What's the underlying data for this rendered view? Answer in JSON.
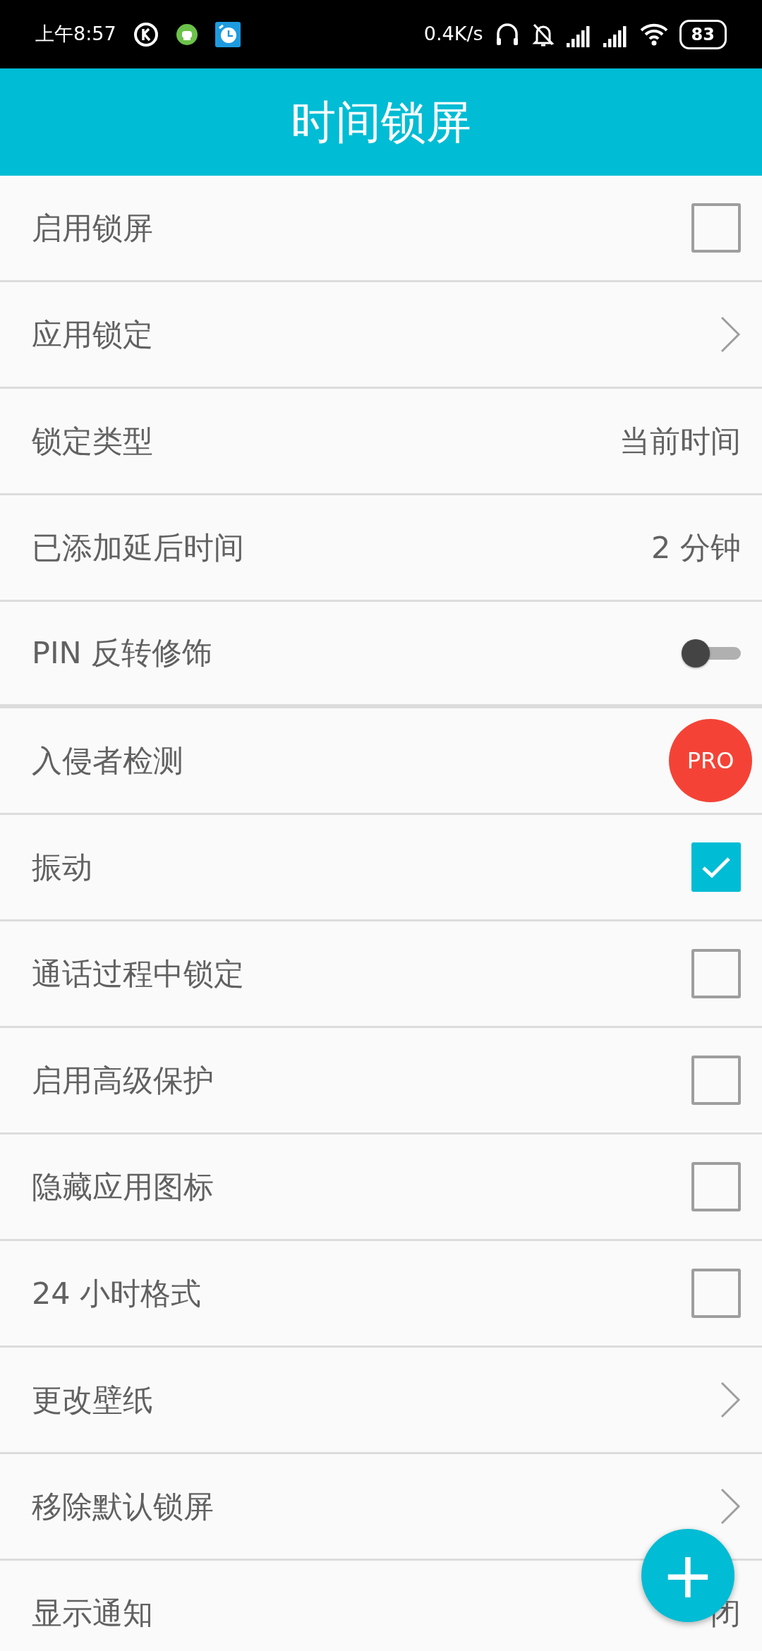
{
  "status_bar": {
    "time": "上午8:57",
    "speed": "0.4K/s",
    "battery": "83"
  },
  "app_bar": {
    "title": "时间锁屏"
  },
  "settings": [
    {
      "kind": "checkbox",
      "label": "启用锁屏",
      "checked": false
    },
    {
      "kind": "link",
      "label": "应用锁定"
    },
    {
      "kind": "value",
      "label": "锁定类型",
      "value": "当前时间"
    },
    {
      "kind": "value",
      "label": "已添加延后时间",
      "value": "2 分钟"
    },
    {
      "kind": "toggle",
      "label": "PIN 反转修饰",
      "on": false
    },
    {
      "kind": "pro",
      "label": "入侵者检测",
      "badge": "PRO"
    },
    {
      "kind": "checkbox",
      "label": "振动",
      "checked": true
    },
    {
      "kind": "checkbox",
      "label": "通话过程中锁定",
      "checked": false
    },
    {
      "kind": "checkbox",
      "label": "启用高级保护",
      "checked": false
    },
    {
      "kind": "checkbox",
      "label": "隐藏应用图标",
      "checked": false
    },
    {
      "kind": "checkbox",
      "label": "24 小时格式",
      "checked": false
    },
    {
      "kind": "link",
      "label": "更改壁纸"
    },
    {
      "kind": "link",
      "label": "移除默认锁屏"
    },
    {
      "kind": "value",
      "label": "显示通知",
      "value": "闭"
    }
  ],
  "fab": {
    "label": "+"
  }
}
